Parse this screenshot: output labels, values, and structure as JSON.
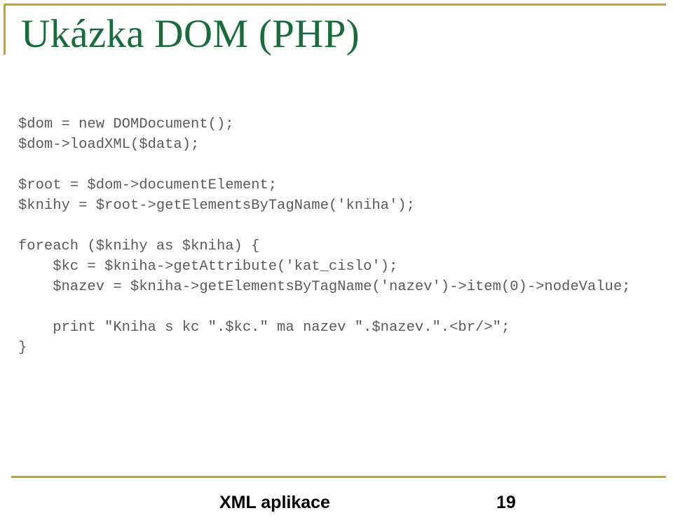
{
  "slide": {
    "title": "Ukázka DOM (PHP)",
    "accent_color": "#c9a227",
    "title_color": "#1a6b3c",
    "code_color": "#5a5a5a",
    "background_color": "#ffffff"
  },
  "code": {
    "language": "php",
    "lines": [
      "$dom = new DOMDocument();",
      "$dom->loadXML($data);",
      "",
      "$root = $dom->documentElement;",
      "$knihy = $root->getElementsByTagName('kniha');",
      "",
      "foreach ($knihy as $kniha) {",
      "    $kc = $kniha->getAttribute('kat_cislo');",
      "    $nazev = $kniha->getElementsByTagName('nazev')->item(0)->nodeValue;",
      "",
      "    print \"Kniha s kc \".$kc.\" ma nazev \".$nazev.\".<br/>\";",
      "}"
    ]
  },
  "footer": {
    "title": "XML aplikace",
    "page_number": "19"
  }
}
